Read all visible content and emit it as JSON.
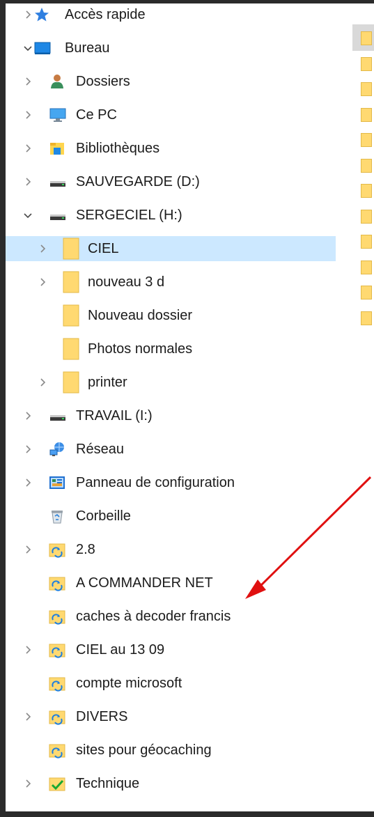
{
  "nav": {
    "items": [
      {
        "label": "Accès rapide",
        "icon": "star-icon",
        "expand": "collapsed",
        "level": 0
      },
      {
        "label": "Bureau",
        "icon": "desktop-icon",
        "expand": "expanded",
        "level": 0
      },
      {
        "label": "Dossiers",
        "icon": "user-folder-icon",
        "expand": "collapsed",
        "level": 1
      },
      {
        "label": "Ce PC",
        "icon": "computer-icon",
        "expand": "collapsed",
        "level": 1
      },
      {
        "label": "Bibliothèques",
        "icon": "libraries-icon",
        "expand": "collapsed",
        "level": 1
      },
      {
        "label": "SAUVEGARDE (D:)",
        "icon": "drive-icon",
        "expand": "collapsed",
        "level": 1
      },
      {
        "label": "SERGECIEL (H:)",
        "icon": "drive-icon",
        "expand": "expanded",
        "level": 1
      },
      {
        "label": "CIEL",
        "icon": "folder-icon",
        "expand": "collapsed",
        "level": 2,
        "selected": true
      },
      {
        "label": "nouveau 3 d",
        "icon": "folder-icon",
        "expand": "collapsed",
        "level": 2
      },
      {
        "label": "Nouveau dossier",
        "icon": "folder-icon",
        "expand": "none",
        "level": 2
      },
      {
        "label": "Photos normales",
        "icon": "folder-icon",
        "expand": "none",
        "level": 2
      },
      {
        "label": "printer",
        "icon": "folder-icon",
        "expand": "collapsed",
        "level": 2
      },
      {
        "label": "TRAVAIL (I:)",
        "icon": "drive-icon",
        "expand": "collapsed",
        "level": 1
      },
      {
        "label": "Réseau",
        "icon": "network-icon",
        "expand": "collapsed",
        "level": 1
      },
      {
        "label": "Panneau de configuration",
        "icon": "control-panel-icon",
        "expand": "collapsed",
        "level": 1
      },
      {
        "label": "Corbeille",
        "icon": "recycle-bin-icon",
        "expand": "none",
        "level": 1
      },
      {
        "label": "2.8",
        "icon": "sync-folder-icon",
        "expand": "collapsed",
        "level": 1
      },
      {
        "label": "A COMMANDER NET",
        "icon": "sync-folder-icon",
        "expand": "none",
        "level": 1
      },
      {
        "label": "caches à decoder francis",
        "icon": "sync-folder-icon",
        "expand": "none",
        "level": 1
      },
      {
        "label": "CIEL au 13 09",
        "icon": "sync-folder-icon",
        "expand": "collapsed",
        "level": 1
      },
      {
        "label": "compte microsoft",
        "icon": "sync-folder-icon",
        "expand": "none",
        "level": 1
      },
      {
        "label": "DIVERS",
        "icon": "sync-folder-icon",
        "expand": "collapsed",
        "level": 1
      },
      {
        "label": "sites pour géocaching",
        "icon": "sync-folder-icon",
        "expand": "none",
        "level": 1
      },
      {
        "label": "Technique",
        "icon": "synced-folder-icon",
        "expand": "collapsed",
        "level": 1
      }
    ]
  },
  "right_pane": {
    "folder_icons": 12
  },
  "annotation": {
    "arrow_color": "#e01010"
  },
  "colors": {
    "selection": "#cce8ff",
    "folder": "#ffd971",
    "frame": "#2b2b2b"
  }
}
